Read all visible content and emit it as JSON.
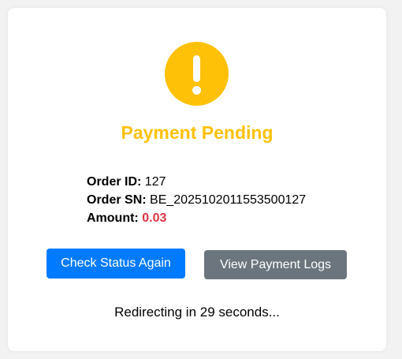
{
  "status": {
    "icon": "exclamation-icon",
    "title": "Payment Pending",
    "color": "#ffc107"
  },
  "order": {
    "id_label": "Order ID:",
    "id_value": "127",
    "sn_label": "Order SN:",
    "sn_value": "BE_2025102011553500127",
    "amount_label": "Amount:",
    "amount_value": "0.03",
    "amount_color": "#dc3545"
  },
  "actions": {
    "check_status_label": "Check Status Again",
    "check_status_color": "#007bff",
    "view_logs_label": "View Payment Logs",
    "view_logs_color": "#6c757d"
  },
  "redirect": {
    "text": "Redirecting in 29 seconds..."
  }
}
